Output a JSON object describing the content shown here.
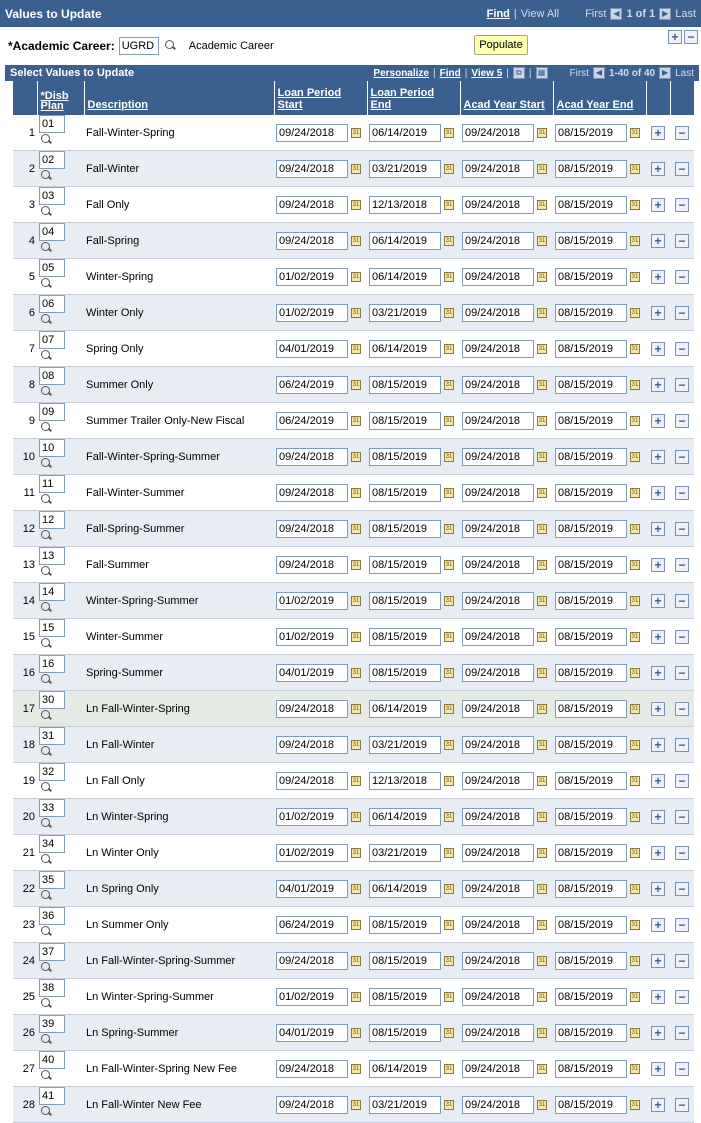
{
  "header": {
    "title": "Values to Update",
    "find": "Find",
    "view_all": "View All",
    "first": "First",
    "range": "1 of 1",
    "last": "Last"
  },
  "career": {
    "label": "*Academic Career:",
    "value": "UGRD",
    "description": "Academic Career"
  },
  "populate": "Populate",
  "grid": {
    "title": "Select Values to Update",
    "personalize": "Personalize",
    "find": "Find",
    "view": "View 5",
    "first": "First",
    "range": "1-40 of 40",
    "last": "Last",
    "cols": [
      "*Disb Plan",
      "Description",
      "Loan Period Start",
      "Loan Period End",
      "Acad Year Start",
      "Acad Year End"
    ],
    "rows": [
      [
        "1",
        "01",
        "Fall-Winter-Spring",
        "09/24/2018",
        "06/14/2019",
        "09/24/2018",
        "08/15/2019"
      ],
      [
        "2",
        "02",
        "Fall-Winter",
        "09/24/2018",
        "03/21/2019",
        "09/24/2018",
        "08/15/2019"
      ],
      [
        "3",
        "03",
        "Fall Only",
        "09/24/2018",
        "12/13/2018",
        "09/24/2018",
        "08/15/2019"
      ],
      [
        "4",
        "04",
        "Fall-Spring",
        "09/24/2018",
        "06/14/2019",
        "09/24/2018",
        "08/15/2019"
      ],
      [
        "5",
        "05",
        "Winter-Spring",
        "01/02/2019",
        "06/14/2019",
        "09/24/2018",
        "08/15/2019"
      ],
      [
        "6",
        "06",
        "Winter Only",
        "01/02/2019",
        "03/21/2019",
        "09/24/2018",
        "08/15/2019"
      ],
      [
        "7",
        "07",
        "Spring Only",
        "04/01/2019",
        "06/14/2019",
        "09/24/2018",
        "08/15/2019"
      ],
      [
        "8",
        "08",
        "Summer Only",
        "06/24/2019",
        "08/15/2019",
        "09/24/2018",
        "08/15/2019"
      ],
      [
        "9",
        "09",
        "Summer Trailer Only-New Fiscal",
        "06/24/2019",
        "08/15/2019",
        "09/24/2018",
        "08/15/2019"
      ],
      [
        "10",
        "10",
        "Fall-Winter-Spring-Summer",
        "09/24/2018",
        "08/15/2019",
        "09/24/2018",
        "08/15/2019"
      ],
      [
        "11",
        "11",
        "Fall-Winter-Summer",
        "09/24/2018",
        "08/15/2019",
        "09/24/2018",
        "08/15/2019"
      ],
      [
        "12",
        "12",
        "Fall-Spring-Summer",
        "09/24/2018",
        "08/15/2019",
        "09/24/2018",
        "08/15/2019"
      ],
      [
        "13",
        "13",
        "Fall-Summer",
        "09/24/2018",
        "08/15/2019",
        "09/24/2018",
        "08/15/2019"
      ],
      [
        "14",
        "14",
        "Winter-Spring-Summer",
        "01/02/2019",
        "08/15/2019",
        "09/24/2018",
        "08/15/2019"
      ],
      [
        "15",
        "15",
        "Winter-Summer",
        "01/02/2019",
        "08/15/2019",
        "09/24/2018",
        "08/15/2019"
      ],
      [
        "16",
        "16",
        "Spring-Summer",
        "04/01/2019",
        "08/15/2019",
        "09/24/2018",
        "08/15/2019"
      ],
      [
        "17",
        "30",
        "Ln Fall-Winter-Spring",
        "09/24/2018",
        "06/14/2019",
        "09/24/2018",
        "08/15/2019"
      ],
      [
        "18",
        "31",
        "Ln Fall-Winter",
        "09/24/2018",
        "03/21/2019",
        "09/24/2018",
        "08/15/2019"
      ],
      [
        "19",
        "32",
        "Ln Fall Only",
        "09/24/2018",
        "12/13/2018",
        "09/24/2018",
        "08/15/2019"
      ],
      [
        "20",
        "33",
        "Ln Winter-Spring",
        "01/02/2019",
        "06/14/2019",
        "09/24/2018",
        "08/15/2019"
      ],
      [
        "21",
        "34",
        "Ln Winter Only",
        "01/02/2019",
        "03/21/2019",
        "09/24/2018",
        "08/15/2019"
      ],
      [
        "22",
        "35",
        "Ln Spring Only",
        "04/01/2019",
        "06/14/2019",
        "09/24/2018",
        "08/15/2019"
      ],
      [
        "23",
        "36",
        "Ln Summer Only",
        "06/24/2019",
        "08/15/2019",
        "09/24/2018",
        "08/15/2019"
      ],
      [
        "24",
        "37",
        "Ln Fall-Winter-Spring-Summer",
        "09/24/2018",
        "08/15/2019",
        "09/24/2018",
        "08/15/2019"
      ],
      [
        "25",
        "38",
        "Ln Winter-Spring-Summer",
        "01/02/2019",
        "08/15/2019",
        "09/24/2018",
        "08/15/2019"
      ],
      [
        "26",
        "39",
        "Ln Spring-Summer",
        "04/01/2019",
        "08/15/2019",
        "09/24/2018",
        "08/15/2019"
      ],
      [
        "27",
        "40",
        "Ln Fall-Winter-Spring New Fee",
        "09/24/2018",
        "06/14/2019",
        "09/24/2018",
        "08/15/2019"
      ],
      [
        "28",
        "41",
        "Ln Fall-Winter New Fee",
        "09/24/2018",
        "03/21/2019",
        "09/24/2018",
        "08/15/2019"
      ]
    ]
  },
  "icons": {
    "lookup": "magnifier-icon",
    "calendar": "calendar-icon",
    "add": "plus-icon",
    "delete": "minus-icon"
  }
}
